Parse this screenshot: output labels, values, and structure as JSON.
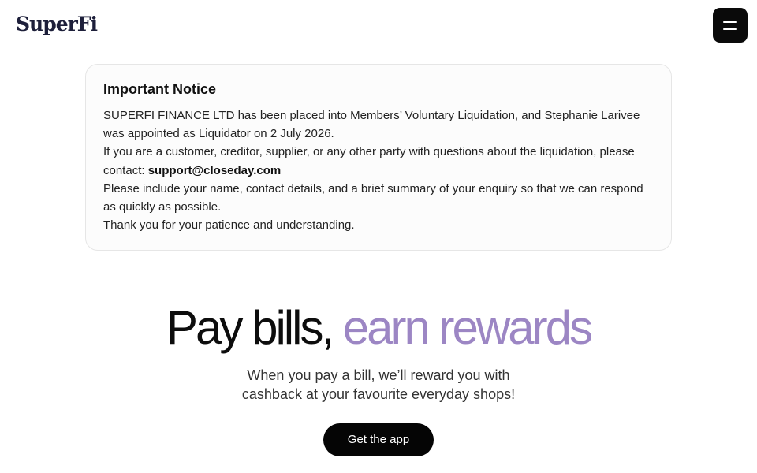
{
  "header": {
    "logo_text": "SuperFi",
    "menu_icon": "hamburger-menu-icon"
  },
  "notice": {
    "title": "Important Notice",
    "paragraph_1": "SUPERFI FINANCE LTD has been placed into Members’ Voluntary Liquidation, and Stephanie Larivee was appointed as Liquidator on 2 July 2026.",
    "paragraph_2_text": "If you are a customer, creditor, supplier, or any other party with questions about the liquidation, please contact: ",
    "contact_email": "support@closeday.com",
    "paragraph_3": "Please include your name, contact details, and a brief summary of your enquiry so that we can respond as quickly as possible.",
    "paragraph_4": "Thank you for your patience and understanding."
  },
  "hero": {
    "title_part1": "Pay bills, ",
    "title_part2": "earn rewards",
    "subtitle_line1": "When you pay a bill, we’ll reward you with",
    "subtitle_line2": "cashback at your favourite everyday shops!",
    "cta_label": "Get the app",
    "accent_color": "#9c86c4"
  }
}
